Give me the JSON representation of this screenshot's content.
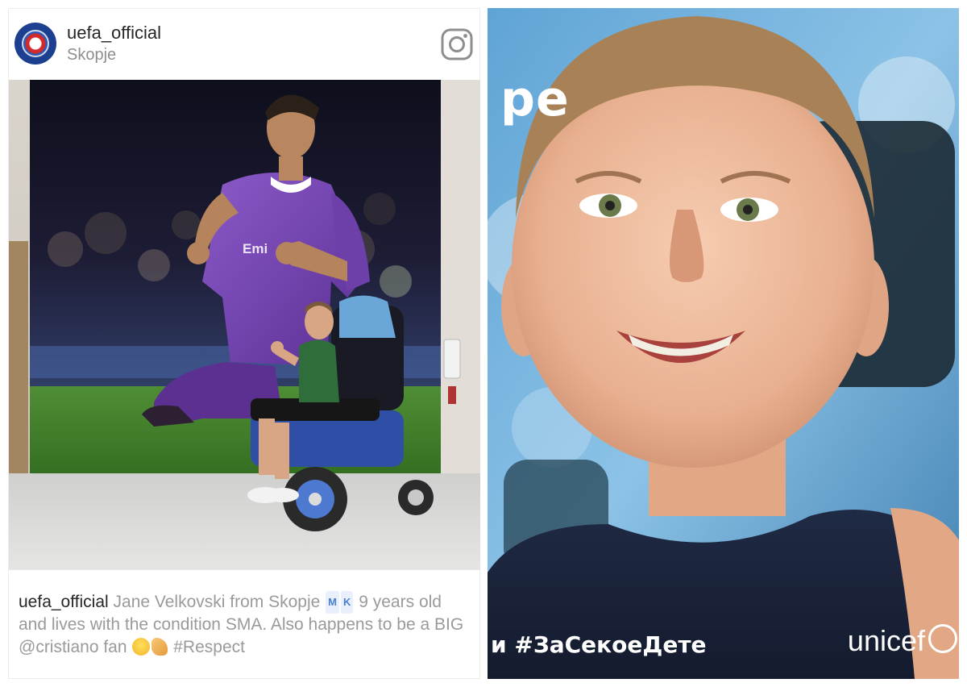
{
  "instagram_post": {
    "username": "uefa_official",
    "location": "Skopje",
    "avatar_icon": "uefa-logo",
    "platform_icon": "instagram-icon",
    "caption": {
      "username": "uefa_official",
      "text_before_flag": " Jane Velkovski from Skopje ",
      "flag_letters": [
        "M",
        "K"
      ],
      "text_after_flag": " 9 years old and lives with the condition SMA. Also happens to be a BIG @cristiano fan ",
      "emojis": [
        "grinning-sweat-emoji",
        "flexed-biceps-emoji"
      ],
      "hashtag": "#Respect"
    }
  },
  "poster": {
    "big_letters": "pe",
    "hashtag": "и #ЗаСекоеДете",
    "brand": "unicef"
  }
}
